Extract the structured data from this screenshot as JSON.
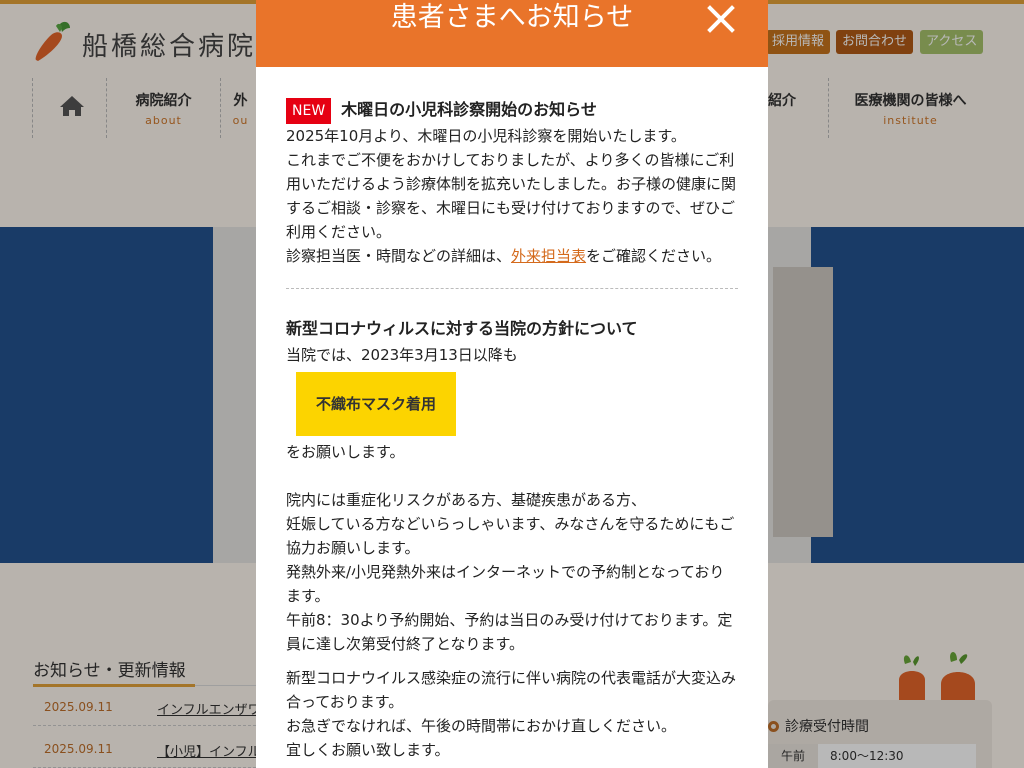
{
  "header": {
    "hospital_name": "船橋総合病院",
    "buttons": [
      {
        "label": "採用情報",
        "color": "#c7741c"
      },
      {
        "label": "お問合わせ",
        "color": "#b25a17"
      },
      {
        "label": "アクセス",
        "color": "#a7c36b"
      }
    ]
  },
  "nav": {
    "items": [
      {
        "jp": "病院紹介",
        "en": "about"
      },
      {
        "jp": "外",
        "en": "ou"
      },
      {
        "jp": "紹介",
        "en": ""
      },
      {
        "jp": "医療機関の皆様へ",
        "en": "institute"
      }
    ]
  },
  "news": {
    "heading": "お知らせ・更新情報",
    "rows": [
      {
        "date": "2025.09.11",
        "title": "インフルエンザワ"
      },
      {
        "date": "2025.09.11",
        "title": "【小児】インフル"
      }
    ]
  },
  "hours": {
    "title": "診療受付時間",
    "rows": [
      {
        "label": "午前",
        "value": "8:00〜12:30"
      }
    ]
  },
  "modal": {
    "title": "患者さまへお知らせ",
    "notice1": {
      "badge": "NEW",
      "title": "木曜日の小児科診察開始のお知らせ",
      "lines": [
        "2025年10月より、木曜日の小児科診察を開始いたします。",
        "これまでご不便をおかけしておりましたが、より多くの皆様にご利用いただけるよう診療体制を拡充いたしました。お子様の健康に関するご相談・診察を、木曜日にも受け付けておりますので、ぜひご利用ください。"
      ],
      "detail_prefix": "診察担当医・時間などの詳細は、",
      "detail_link": "外来担当表",
      "detail_suffix": "をご確認ください。"
    },
    "notice2": {
      "title": "新型コロナウィルスに対する当院の方針について",
      "intro": "当院では、2023年3月13日以降も",
      "mask_label": "不織布マスク着用",
      "request": "をお願いします。",
      "paragraph1": "院内には重症化リスクがある方、基礎疾患がある方、",
      "paragraph2": "妊娠している方などいらっしゃいます、みなさんを守るためにもご協力お願いします。",
      "paragraph3": "発熱外来/小児発熱外来はインターネットでの予約制となっております。",
      "paragraph4": "午前8：30より予約開始、予約は当日のみ受け付けております。定員に達し次第受付終了となります。",
      "paragraph5": "新型コロナウイルス感染症の流行に伴い病院の代表電話が大変込み合っております。",
      "paragraph6": "お急ぎでなければ、午後の時間帯におかけ直しください。",
      "paragraph7": "宜しくお願い致します。"
    }
  }
}
